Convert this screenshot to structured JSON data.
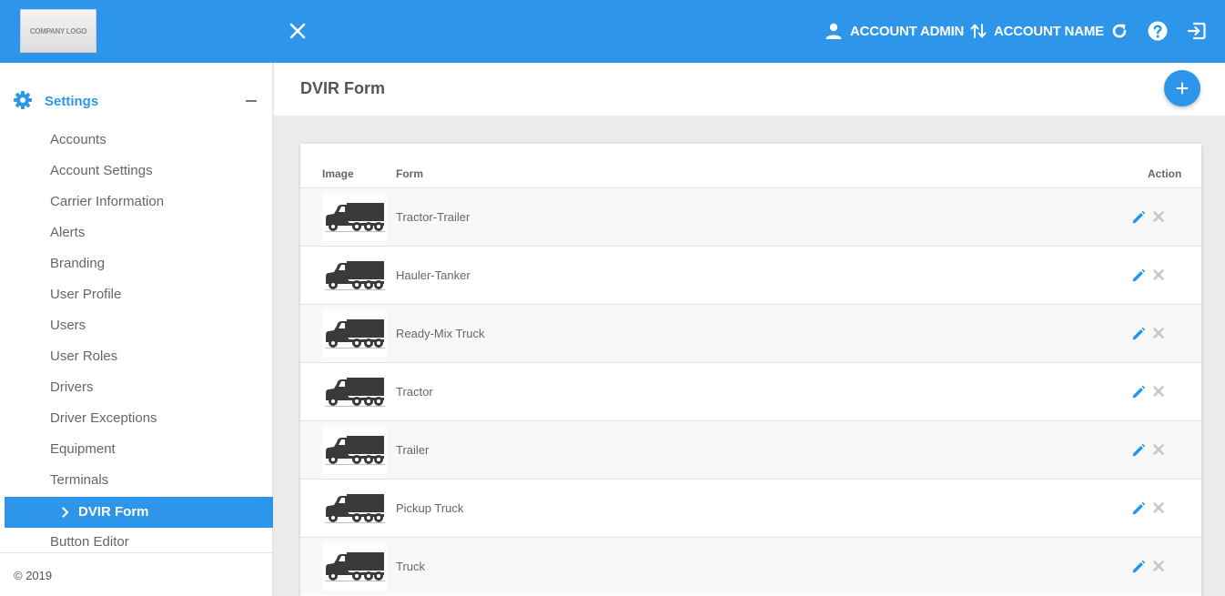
{
  "header": {
    "logo_text": "COMPANY LOGO",
    "account_admin": "ACCOUNT ADMIN",
    "account_name": "ACCOUNT NAME"
  },
  "sidebar": {
    "section_label": "Settings",
    "items": [
      {
        "label": "Accounts"
      },
      {
        "label": "Account Settings"
      },
      {
        "label": "Carrier Information"
      },
      {
        "label": "Alerts"
      },
      {
        "label": "Branding"
      },
      {
        "label": "User Profile"
      },
      {
        "label": "Users"
      },
      {
        "label": "User Roles"
      },
      {
        "label": "Drivers"
      },
      {
        "label": "Driver Exceptions"
      },
      {
        "label": "Equipment"
      },
      {
        "label": "Terminals"
      }
    ],
    "active_item": "DVIR Form",
    "after_item": "Button Editor",
    "footer": "© 2019"
  },
  "main": {
    "title": "DVIR Form",
    "table": {
      "columns": [
        "Image",
        "Form",
        "Action"
      ],
      "rows": [
        {
          "form": "Tractor-Trailer"
        },
        {
          "form": "Hauler-Tanker"
        },
        {
          "form": "Ready-Mix Truck"
        },
        {
          "form": "Tractor"
        },
        {
          "form": "Trailer"
        },
        {
          "form": "Pickup Truck"
        },
        {
          "form": "Truck"
        }
      ]
    }
  },
  "colors": {
    "primary": "#2d96ea",
    "delete_icon": "#c8c8c8"
  },
  "icons": {
    "close": "close-icon",
    "user": "user-icon",
    "switch": "swap-vertical-icon",
    "refresh": "refresh-icon",
    "help": "help-icon",
    "logout": "logout-icon",
    "settings": "gear-icon",
    "collapse": "minus-icon",
    "active": "chevron-right-icon",
    "add": "plus-icon",
    "truck": "truck-icon",
    "edit": "pencil-icon",
    "delete": "x-icon"
  }
}
